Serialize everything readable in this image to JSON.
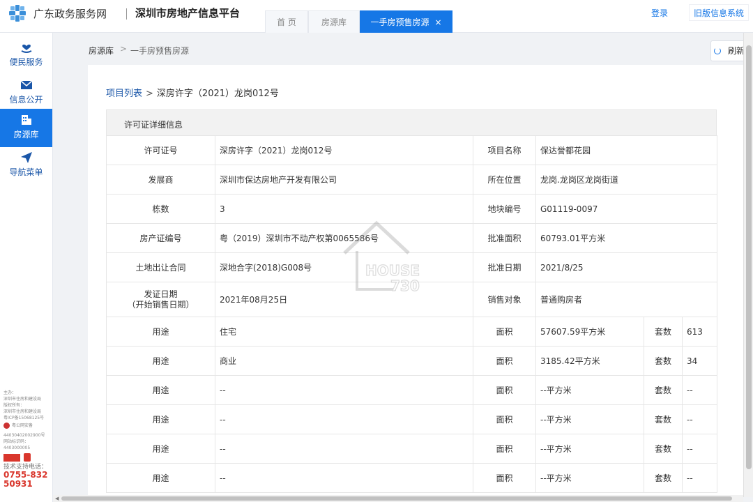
{
  "header": {
    "gov_site": "广东政务服务网",
    "platform": "深圳市房地产信息平台",
    "tabs": [
      {
        "label": "首 页"
      },
      {
        "label": "房源库"
      },
      {
        "label": "一手房预售房源",
        "close": "×"
      }
    ],
    "login": "登录",
    "old_system": "旧版信息系统",
    "accent": "#1677e6"
  },
  "sidebar": {
    "items": [
      {
        "label": "便民服务",
        "icon": "heart-hand-icon"
      },
      {
        "label": "信息公开",
        "icon": "mail-icon"
      },
      {
        "label": "房源库",
        "icon": "building-icon",
        "active": true
      },
      {
        "label": "导航菜单",
        "icon": "send-icon"
      }
    ],
    "footer": {
      "line1": "主办：",
      "line2": "深圳市住房和建设局",
      "line3": "版权所有：",
      "line4": "深圳市住房和建设局",
      "line5": "粤ICP备15068125号",
      "police": "粤公网安备",
      "police_no": "44030402002900号",
      "site_code_label": "网站标识码：",
      "site_code": "4403000005",
      "tech_label": "技术支持电话：",
      "tech_phone1": "0755-832",
      "tech_phone2": "50931"
    }
  },
  "breadcrumb": {
    "root": "房源库",
    "separator": ">",
    "current": "一手房预售房源"
  },
  "refresh_label": "刷新",
  "sub_breadcrumb": {
    "link": "项目列表",
    "arrow": ">",
    "current": "深房许字（2021）龙岗012号"
  },
  "table_title": "许可证详细信息",
  "details": {
    "permit_no_label": "许可证号",
    "permit_no": "深房许字（2021）龙岗012号",
    "project_name_label": "项目名称",
    "project_name": "保达誉都花园",
    "developer_label": "发展商",
    "developer": "深圳市保达房地产开发有限公司",
    "location_label": "所在位置",
    "location": "龙岗.龙岗区龙岗街道",
    "buildings_label": "栋数",
    "buildings": "3",
    "parcel_label": "地块编号",
    "parcel": "G01119-0097",
    "cert_label": "房产证编号",
    "cert": "粤（2019）深圳市不动产权第0065586号",
    "approved_area_label": "批准面积",
    "approved_area": "60793.01平方米",
    "land_contract_label": "土地出让合同",
    "land_contract": "深地合字(2018)G008号",
    "approval_date_label": "批准日期",
    "approval_date": "2021/8/25",
    "issue_date_label1": "发证日期",
    "issue_date_label2": "（开始销售日期）",
    "issue_date": "2021年08月25日",
    "sales_target_label": "销售对象",
    "sales_target": "普通购房者"
  },
  "usage_rows": [
    {
      "use_label": "用途",
      "use": "住宅",
      "area_label": "面积",
      "area": "57607.59平方米",
      "units_label": "套数",
      "units": "613"
    },
    {
      "use_label": "用途",
      "use": "商业",
      "area_label": "面积",
      "area": "3185.42平方米",
      "units_label": "套数",
      "units": "34"
    },
    {
      "use_label": "用途",
      "use": "--",
      "area_label": "面积",
      "area": "--平方米",
      "units_label": "套数",
      "units": "--"
    },
    {
      "use_label": "用途",
      "use": "--",
      "area_label": "面积",
      "area": "--平方米",
      "units_label": "套数",
      "units": "--"
    },
    {
      "use_label": "用途",
      "use": "--",
      "area_label": "面积",
      "area": "--平方米",
      "units_label": "套数",
      "units": "--"
    },
    {
      "use_label": "用途",
      "use": "--",
      "area_label": "面积",
      "area": "--平方米",
      "units_label": "套数",
      "units": "--"
    }
  ],
  "watermark": {
    "line1": "HOUSE",
    "line2": "730"
  }
}
